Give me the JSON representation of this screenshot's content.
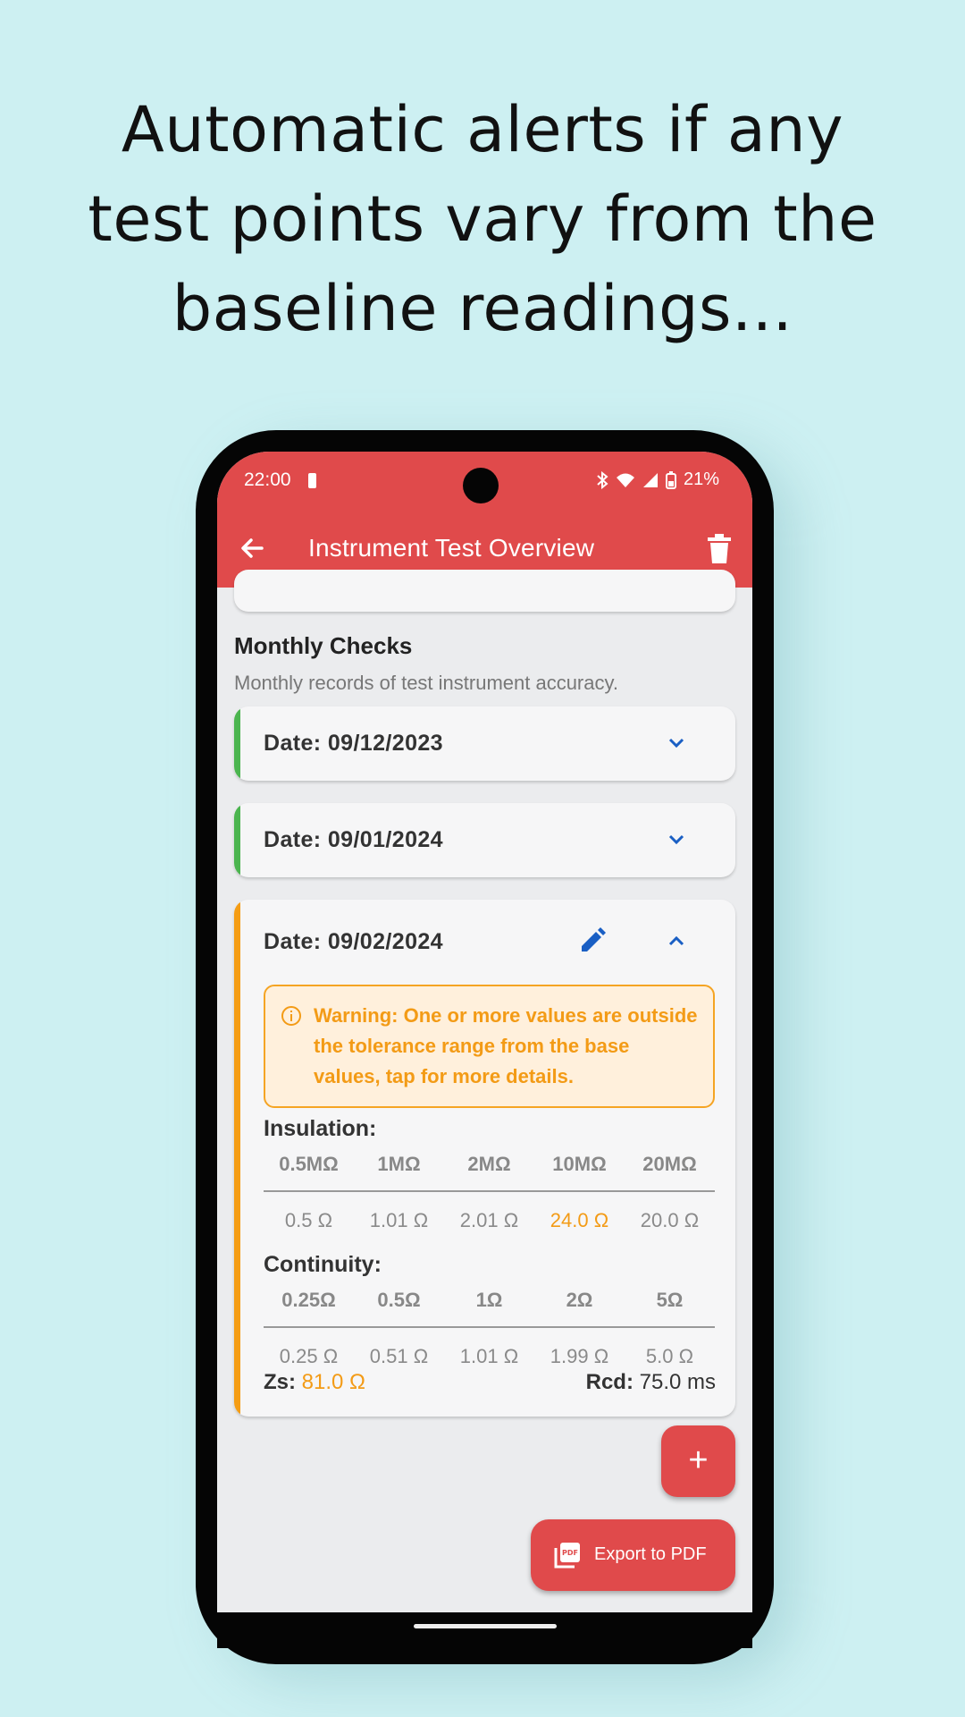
{
  "headline": "Automatic alerts if any test points vary from the baseline readings...",
  "status": {
    "time": "22:00",
    "battery": "21%"
  },
  "appbar": {
    "title": "Instrument Test Overview"
  },
  "section": {
    "title": "Monthly Checks",
    "subtitle": "Monthly records of test instrument accuracy."
  },
  "cards": [
    {
      "date": "Date: 09/12/2023",
      "status": "ok"
    },
    {
      "date": "Date: 09/01/2024",
      "status": "ok"
    },
    {
      "date": "Date: 09/02/2024",
      "status": "warning",
      "warning": "Warning: One or more values are outside the tolerance range from the base values, tap for more details.",
      "insulation": {
        "label": "Insulation:",
        "headers": [
          "0.5MΩ",
          "1MΩ",
          "2MΩ",
          "10MΩ",
          "20MΩ"
        ],
        "values": [
          "0.5 Ω",
          "1.01 Ω",
          "2.01 Ω",
          "24.0 Ω",
          "20.0 Ω"
        ]
      },
      "continuity": {
        "label": "Continuity:",
        "headers": [
          "0.25Ω",
          "0.5Ω",
          "1Ω",
          "2Ω",
          "5Ω"
        ],
        "values": [
          "0.25 Ω",
          "0.51 Ω",
          "1.01 Ω",
          "1.99 Ω",
          "5.0 Ω"
        ]
      },
      "zs_label": "Zs:",
      "zs_value": "81.0 Ω",
      "rcd_label": "Rcd:",
      "rcd_value": "75.0 ms"
    }
  ],
  "fab": {
    "label": "+"
  },
  "export": {
    "label": "Export to PDF"
  },
  "colors": {
    "accent": "#e04a4b",
    "ok": "#4bb54f",
    "warning": "#f59d14",
    "link": "#1565c0",
    "background": "#cdf0f2"
  },
  "icons": [
    "back-arrow-icon",
    "trash-icon",
    "chevron-down-icon",
    "chevron-up-icon",
    "edit-pencil-icon",
    "info-icon",
    "pdf-icon",
    "bluetooth-icon",
    "wifi-icon",
    "signal-icon",
    "battery-icon"
  ]
}
